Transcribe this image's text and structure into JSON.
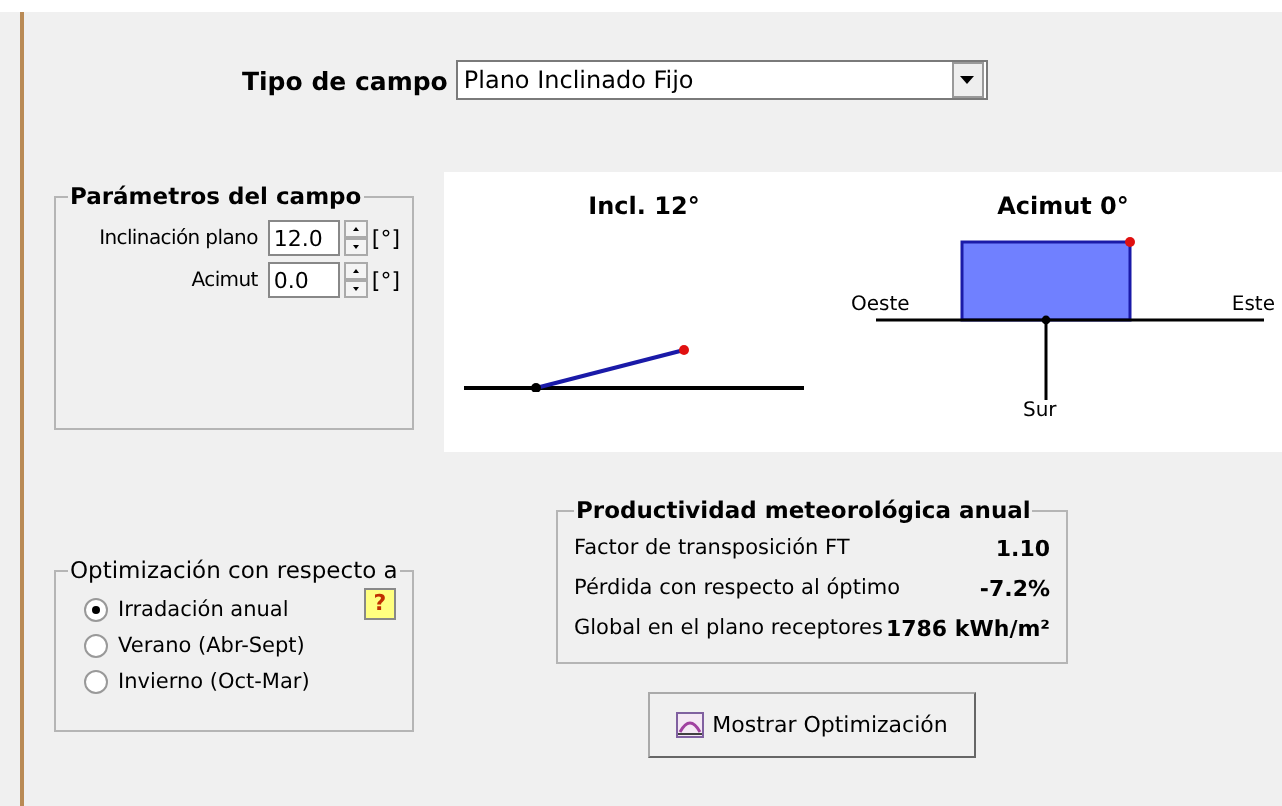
{
  "field_type": {
    "label": "Tipo de campo",
    "value": "Plano Inclinado Fijo"
  },
  "parameters": {
    "title": "Parámetros del campo",
    "fields": [
      {
        "label": "Inclinación plano",
        "value": "12.0",
        "unit": "[°]"
      },
      {
        "label": "Acimut",
        "value": "0.0",
        "unit": "[°]"
      }
    ]
  },
  "diagrams": {
    "tilt_title": "Incl. 12°",
    "azimuth_title": "Acimut 0°",
    "west": "Oeste",
    "east": "Este",
    "south": "Sur"
  },
  "optimization": {
    "title": "Optimización con respecto a",
    "help": "?",
    "options": [
      {
        "label": "Irradación anual",
        "selected": true
      },
      {
        "label": "Verano (Abr-Sept)",
        "selected": false
      },
      {
        "label": "Invierno (Oct-Mar)",
        "selected": false
      }
    ]
  },
  "productivity": {
    "title": "Productividad meteorológica anual",
    "rows": [
      {
        "label": "Factor de transposición FT",
        "value": "1.10"
      },
      {
        "label": "Pérdida con respecto al óptimo",
        "value": "-7.2%"
      },
      {
        "label": "Global en el plano receptores",
        "value": "1786 kWh/m²"
      }
    ]
  },
  "show_button": "Mostrar Optimización"
}
